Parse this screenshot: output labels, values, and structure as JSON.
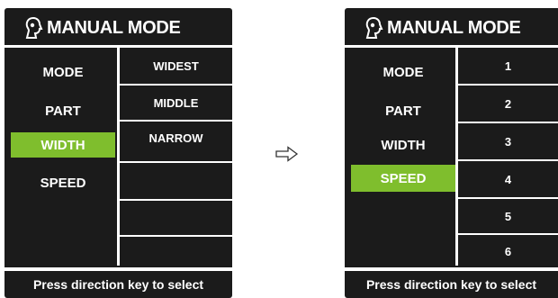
{
  "left_screen": {
    "title": "MANUAL MODE",
    "menu": [
      {
        "label": "MODE",
        "selected": false
      },
      {
        "label": "PART",
        "selected": false
      },
      {
        "label": "WIDTH",
        "selected": true
      },
      {
        "label": "SPEED",
        "selected": false
      }
    ],
    "options": [
      "WIDEST",
      "MIDDLE",
      "NARROW",
      "",
      "",
      ""
    ],
    "footer": "Press direction key to select"
  },
  "right_screen": {
    "title": "MANUAL MODE",
    "menu": [
      {
        "label": "MODE",
        "selected": false
      },
      {
        "label": "PART",
        "selected": false
      },
      {
        "label": "WIDTH",
        "selected": false
      },
      {
        "label": "SPEED",
        "selected": true
      }
    ],
    "options": [
      "1",
      "2",
      "3",
      "4",
      "5",
      "6"
    ],
    "footer": "Press direction key to select"
  },
  "colors": {
    "screen_background": "#1b1b1b",
    "text": "#ffffff",
    "selection_highlight": "#7fbe2d"
  },
  "icons": {
    "title_icon": "user-head-icon",
    "transition_arrow": "right-arrow-icon"
  }
}
